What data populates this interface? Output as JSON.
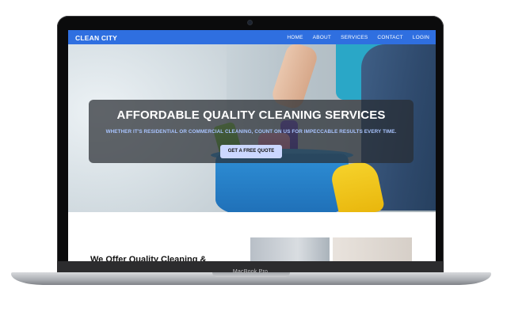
{
  "device": {
    "model_label": "MacBook Pro"
  },
  "site": {
    "brand": "CLEAN CITY",
    "nav": [
      {
        "label": "HOME"
      },
      {
        "label": "ABOUT"
      },
      {
        "label": "SERVICES"
      },
      {
        "label": "CONTACT"
      },
      {
        "label": "LOGIN"
      }
    ],
    "hero": {
      "title": "AFFORDABLE QUALITY CLEANING SERVICES",
      "subtitle": "WHETHER IT'S RESIDENTIAL OR COMMERCIAL CLEANING, COUNT ON US FOR IMPECCABLE RESULTS EVERY TIME.",
      "cta_label": "GET A FREE QUOTE"
    },
    "section": {
      "heading_partial": "We Offer Quality Cleaning &"
    }
  },
  "colors": {
    "navbar": "#2f6fe0",
    "cta_background": "#cbd7ff",
    "subtitle": "#a9c4ff",
    "overlay": "rgba(40,44,50,0.72)"
  }
}
